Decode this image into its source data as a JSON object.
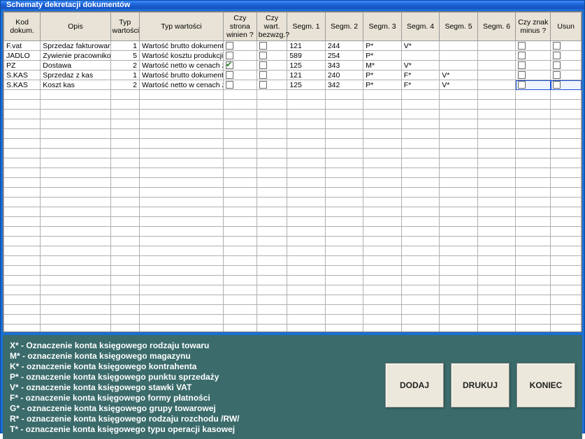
{
  "window": {
    "title": "Schematy dekretacji dokumentów"
  },
  "columns": [
    "Kod dokum.",
    "Opis",
    "Typ wartości",
    "Typ wartości",
    "Czy strona winien ?",
    "Czy wart. bezwzg.?",
    "Segm. 1",
    "Segm. 2",
    "Segm. 3",
    "Segm. 4",
    "Segm. 5",
    "Segm. 6",
    "Czy znak minus ?",
    "Usun"
  ],
  "rows": [
    {
      "kod": "F.vat",
      "opis": "Sprzedaz fakturowana",
      "typwartNo": "1",
      "typwart": "Wartość brutto dokumentu",
      "winien": false,
      "bezwzg": false,
      "s1": "121",
      "s2": "244",
      "s3": "P*",
      "s4": "V*",
      "s5": "",
      "s6": "",
      "minus": false,
      "usun": false
    },
    {
      "kod": "JADLO",
      "opis": "Zywienie pracownikow",
      "typwartNo": "5",
      "typwart": "Wartość kosztu produkcji",
      "winien": false,
      "bezwzg": false,
      "s1": "589",
      "s2": "254",
      "s3": "P*",
      "s4": "",
      "s5": "",
      "s6": "",
      "minus": false,
      "usun": false
    },
    {
      "kod": "PZ",
      "opis": "Dostawa",
      "typwartNo": "2",
      "typwart": "Wartość netto w cenach zaku",
      "winien": true,
      "bezwzg": false,
      "s1": "125",
      "s2": "343",
      "s3": "M*",
      "s4": "V*",
      "s5": "",
      "s6": "",
      "minus": false,
      "usun": false
    },
    {
      "kod": "S.KAS",
      "opis": "Sprzedaz z kas",
      "typwartNo": "1",
      "typwart": "Wartość brutto dokumentu",
      "winien": false,
      "bezwzg": false,
      "s1": "121",
      "s2": "240",
      "s3": "P*",
      "s4": "F*",
      "s5": "V*",
      "s6": "",
      "minus": false,
      "usun": false
    },
    {
      "kod": "S.KAS",
      "opis": "Koszt kas",
      "typwartNo": "2",
      "typwart": "Wartość netto w cenach zaku",
      "winien": false,
      "bezwzg": false,
      "s1": "125",
      "s2": "342",
      "s3": "P*",
      "s4": "F*",
      "s5": "V*",
      "s6": "",
      "minus": false,
      "usun": false,
      "sel": true
    }
  ],
  "emptyRows": 25,
  "legend": [
    "X* - Oznaczenie konta księgowego rodzaju towaru",
    "M* - oznaczenie konta księgowego magazynu",
    "K* - oznaczenie konta księgowego kontrahenta",
    "P* - oznaczenie konta księgowego punktu sprzedaży",
    "V* - oznaczenie konta księgowego stawki VAT",
    "F* - oznaczenie konta księgowego formy płatności",
    "G* - oznaczenie konta księgowego grupy towarowej",
    "R* - oznaczenie konta księgowego rodzaju rozchodu /RW/",
    "T* - oznaczenie konta księgowego typu operacji kasowej"
  ],
  "buttons": {
    "add": "DODAJ",
    "print": "DRUKUJ",
    "close": "KONIEC"
  }
}
